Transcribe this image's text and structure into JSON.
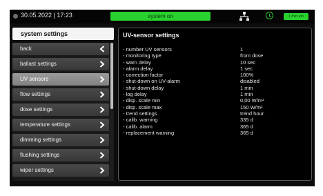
{
  "header": {
    "datetime": "30.05.2022 | 17:23",
    "status": "system on",
    "timer_label": "1 min ein",
    "accent_color": "#29d12f"
  },
  "menu": {
    "title": "system settings",
    "items": [
      {
        "label": "back",
        "chevron": "chevron-left-icon"
      },
      {
        "label": "ballast settings",
        "chevron": "chevron-right-icon"
      },
      {
        "label": "UV sensors",
        "chevron": "chevron-right-icon",
        "active": true
      },
      {
        "label": "flow settings",
        "chevron": "chevron-right-icon"
      },
      {
        "label": "dose settings",
        "chevron": "chevron-right-icon"
      },
      {
        "label": "temperature settings",
        "chevron": "chevron-right-icon"
      },
      {
        "label": "dimming settings",
        "chevron": "chevron-right-icon"
      },
      {
        "label": "flushing settings",
        "chevron": "chevron-right-icon"
      },
      {
        "label": "wiper settings",
        "chevron": "chevron-right-icon"
      }
    ]
  },
  "content": {
    "title": "UV-sensor settings",
    "settings": [
      {
        "label": "- number UV sensors",
        "value": "1"
      },
      {
        "label": "- monitoring type",
        "value": "from dose"
      },
      {
        "label": "- warn delay",
        "value": "10 sec"
      },
      {
        "label": "- alarm delay",
        "value": "1 sec"
      },
      {
        "label": "- correction factor",
        "value": "100%"
      },
      {
        "label": "- shut-down on UV-alarm",
        "value": "disabled"
      },
      {
        "label": "- shut-down delay",
        "value": "1 min"
      },
      {
        "label": "- log delay",
        "value": "1 min"
      },
      {
        "label": "- disp. scale min",
        "value": "0,00 W/m²"
      },
      {
        "label": "- disp. scale max",
        "value": "150 W/m²"
      },
      {
        "label": "- trend settings",
        "value": "trend hour"
      },
      {
        "label": "- calib. warning",
        "value": "335 d"
      },
      {
        "label": "- calib. alarm",
        "value": "365 d"
      },
      {
        "label": "- replacement warning",
        "value": "365 d"
      }
    ]
  }
}
